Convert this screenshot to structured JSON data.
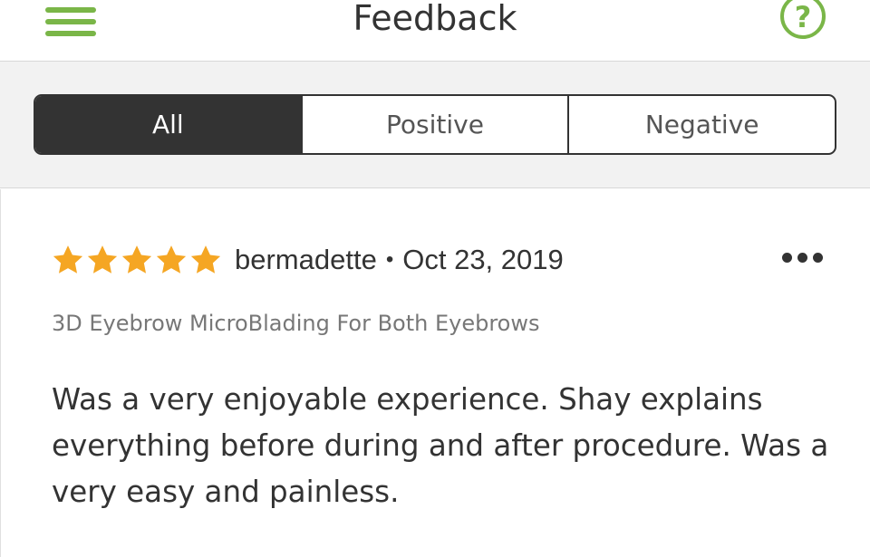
{
  "header": {
    "title": "Feedback",
    "menu_icon": "hamburger-menu-icon",
    "help_icon": "question-circle-icon",
    "accent_color": "#7ab648"
  },
  "filters": {
    "tabs": [
      {
        "label": "All",
        "active": true
      },
      {
        "label": "Positive",
        "active": false
      },
      {
        "label": "Negative",
        "active": false
      }
    ]
  },
  "review": {
    "rating": 5,
    "rating_max": 5,
    "star_color": "#f5a623",
    "author": "bermadette",
    "separator": "•",
    "date": "Oct 23, 2019",
    "service": "3D Eyebrow MicroBlading For Both Eyebrows",
    "comment": "Was a very enjoyable experience. Shay explains everything before during and after procedure. Was a very easy and painless.",
    "more_icon": "more-options-icon"
  }
}
